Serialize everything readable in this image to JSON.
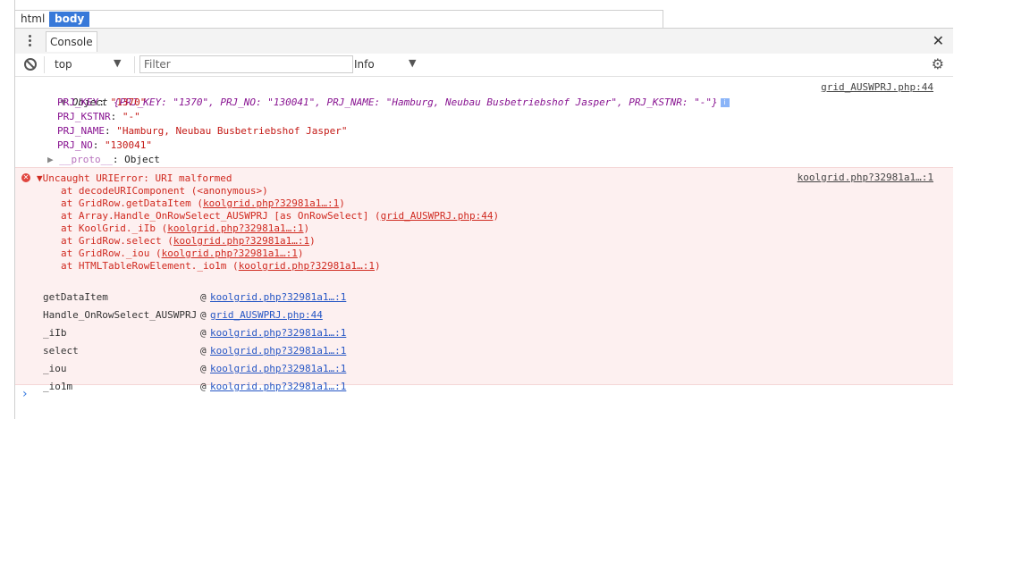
{
  "breadcrumbs": [
    "html",
    "body"
  ],
  "tab": {
    "label": "Console"
  },
  "toolbar": {
    "context": "top",
    "filter_placeholder": "Filter",
    "level": "Info"
  },
  "object_log": {
    "summary_prefix": "Object ",
    "summary": "{PRJ_KEY: \"1370\", PRJ_NO: \"130041\", PRJ_NAME: \"Hamburg, Neubau Busbetriebshof Jasper\", PRJ_KSTNR: \"-\"}",
    "source": "grid_AUSWPRJ.php:44",
    "properties": [
      {
        "key": "PRJ_KEY",
        "value": "\"1370\""
      },
      {
        "key": "PRJ_KSTNR",
        "value": "\"-\""
      },
      {
        "key": "PRJ_NAME",
        "value": "\"Hamburg, Neubau Busbetriebshof Jasper\""
      },
      {
        "key": "PRJ_NO",
        "value": "\"130041\""
      }
    ],
    "proto_key": "__proto__",
    "proto_value": "Object"
  },
  "error_log": {
    "message": "Uncaught URIError: URI malformed",
    "source": "koolgrid.php?32981a1…:1",
    "stack": [
      {
        "text": "at decodeURIComponent (<anonymous>)",
        "link": ""
      },
      {
        "text": "at GridRow.getDataItem (",
        "link": "koolgrid.php?32981a1…:1",
        "suffix": ")"
      },
      {
        "text": "at Array.Handle_OnRowSelect_AUSWPRJ [as OnRowSelect] (",
        "link": "grid_AUSWPRJ.php:44",
        "suffix": ")"
      },
      {
        "text": "at KoolGrid._iIb (",
        "link": "koolgrid.php?32981a1…:1",
        "suffix": ")"
      },
      {
        "text": "at GridRow.select (",
        "link": "koolgrid.php?32981a1…:1",
        "suffix": ")"
      },
      {
        "text": "at GridRow._iou (",
        "link": "koolgrid.php?32981a1…:1",
        "suffix": ")"
      },
      {
        "text": "at HTMLTableRowElement._io1m (",
        "link": "koolgrid.php?32981a1…:1",
        "suffix": ")"
      }
    ],
    "frames": [
      {
        "name": "getDataItem",
        "link": "koolgrid.php?32981a1…:1"
      },
      {
        "name": "Handle_OnRowSelect_AUSWPRJ",
        "link": "grid_AUSWPRJ.php:44"
      },
      {
        "name": "_iIb",
        "link": "koolgrid.php?32981a1…:1"
      },
      {
        "name": "select",
        "link": "koolgrid.php?32981a1…:1"
      },
      {
        "name": "_iou",
        "link": "koolgrid.php?32981a1…:1"
      },
      {
        "name": "_io1m",
        "link": "koolgrid.php?32981a1…:1"
      }
    ]
  },
  "prompt_symbol": "›"
}
